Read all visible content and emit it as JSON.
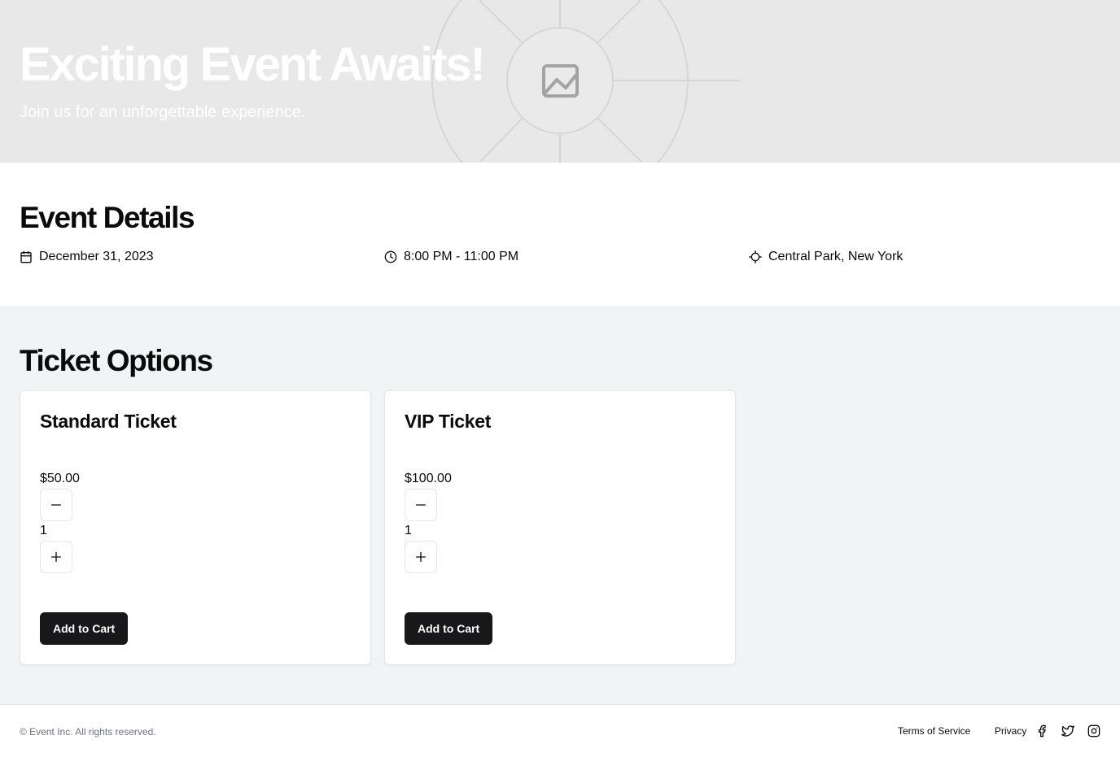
{
  "hero": {
    "title": "Exciting Event Awaits!",
    "subtitle": "Join us for an unforgettable experience.",
    "image_icon": "image-placeholder-icon"
  },
  "details": {
    "title": "Event Details",
    "date": {
      "icon": "calendar-icon",
      "text": "December 31, 2023"
    },
    "time": {
      "icon": "clock-icon",
      "text": "8:00 PM - 11:00 PM"
    },
    "location": {
      "icon": "crosshair-icon",
      "text": "Central Park, New York"
    }
  },
  "tickets": {
    "title": "Ticket Options",
    "items": [
      {
        "name": "Standard Ticket",
        "price": "$50.00",
        "quantity": "1",
        "minus_icon": "minus-icon",
        "plus_icon": "plus-icon",
        "cart_label": "Add to Cart"
      },
      {
        "name": "VIP Ticket",
        "price": "$100.00",
        "quantity": "1",
        "minus_icon": "minus-icon",
        "plus_icon": "plus-icon",
        "cart_label": "Add to Cart"
      }
    ]
  },
  "footer": {
    "copyright": "© Event Inc. All rights reserved.",
    "links": [
      "Terms of Service",
      "Privacy"
    ],
    "social_icons": [
      "facebook-icon",
      "twitter-icon",
      "instagram-icon"
    ]
  },
  "colors": {
    "hero_bg": "#e8e8e8",
    "tickets_bg": "#f1f3f5",
    "button_dark": "#18181b",
    "muted_text": "#6b7280"
  }
}
